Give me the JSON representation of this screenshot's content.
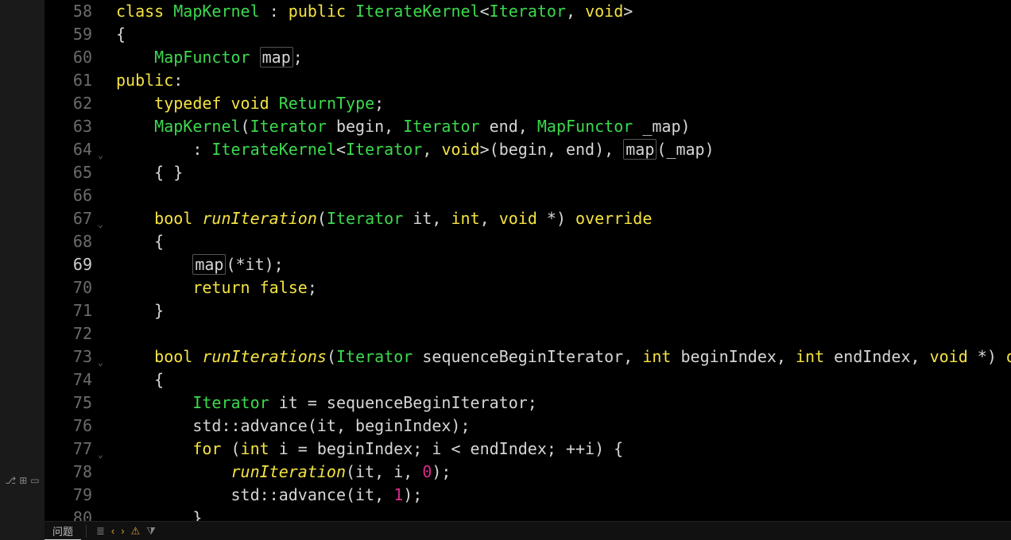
{
  "lineStart": 58,
  "lineEnd": 80,
  "activeLine": 69,
  "breakpointLine": 69,
  "foldLines": [
    64,
    67,
    73,
    77
  ],
  "code": {
    "58": [
      {
        "t": "kw",
        "v": "class"
      },
      {
        "t": "sp",
        "v": " "
      },
      {
        "t": "type",
        "v": "MapKernel"
      },
      {
        "t": "sp",
        "v": " "
      },
      {
        "t": "id",
        "v": ": "
      },
      {
        "t": "kw",
        "v": "public"
      },
      {
        "t": "sp",
        "v": " "
      },
      {
        "t": "type",
        "v": "IterateKernel"
      },
      {
        "t": "id",
        "v": "<"
      },
      {
        "t": "type",
        "v": "Iterator"
      },
      {
        "t": "id",
        "v": ", "
      },
      {
        "t": "kw",
        "v": "void"
      },
      {
        "t": "id",
        "v": ">"
      }
    ],
    "59": [
      {
        "t": "id",
        "v": "{"
      }
    ],
    "60": [
      {
        "t": "sp",
        "v": "    "
      },
      {
        "t": "type",
        "v": "MapFunctor"
      },
      {
        "t": "sp",
        "v": " "
      },
      {
        "t": "boxed",
        "v": "map"
      },
      {
        "t": "id",
        "v": ";"
      }
    ],
    "61": [
      {
        "t": "kw",
        "v": "public"
      },
      {
        "t": "id",
        "v": ":"
      }
    ],
    "62": [
      {
        "t": "sp",
        "v": "    "
      },
      {
        "t": "kw",
        "v": "typedef"
      },
      {
        "t": "sp",
        "v": " "
      },
      {
        "t": "kw",
        "v": "void"
      },
      {
        "t": "sp",
        "v": " "
      },
      {
        "t": "type",
        "v": "ReturnType"
      },
      {
        "t": "id",
        "v": ";"
      }
    ],
    "63": [
      {
        "t": "sp",
        "v": "    "
      },
      {
        "t": "type",
        "v": "MapKernel"
      },
      {
        "t": "id",
        "v": "("
      },
      {
        "t": "type",
        "v": "Iterator"
      },
      {
        "t": "sp",
        "v": " "
      },
      {
        "t": "id",
        "v": "begin, "
      },
      {
        "t": "type",
        "v": "Iterator"
      },
      {
        "t": "sp",
        "v": " "
      },
      {
        "t": "id",
        "v": "end, "
      },
      {
        "t": "type",
        "v": "MapFunctor"
      },
      {
        "t": "sp",
        "v": " "
      },
      {
        "t": "id",
        "v": "_map)"
      }
    ],
    "64": [
      {
        "t": "sp",
        "v": "        "
      },
      {
        "t": "id",
        "v": ": "
      },
      {
        "t": "type",
        "v": "IterateKernel"
      },
      {
        "t": "id",
        "v": "<"
      },
      {
        "t": "type",
        "v": "Iterator"
      },
      {
        "t": "id",
        "v": ", "
      },
      {
        "t": "kw",
        "v": "void"
      },
      {
        "t": "id",
        "v": ">(begin, end), "
      },
      {
        "t": "boxed",
        "v": "map"
      },
      {
        "t": "id",
        "v": "(_map)"
      }
    ],
    "65": [
      {
        "t": "sp",
        "v": "    "
      },
      {
        "t": "id",
        "v": "{ }"
      }
    ],
    "66": [],
    "67": [
      {
        "t": "sp",
        "v": "    "
      },
      {
        "t": "kw",
        "v": "bool"
      },
      {
        "t": "sp",
        "v": " "
      },
      {
        "t": "fn",
        "v": "runIteration"
      },
      {
        "t": "id",
        "v": "("
      },
      {
        "t": "type",
        "v": "Iterator"
      },
      {
        "t": "sp",
        "v": " "
      },
      {
        "t": "id",
        "v": "it, "
      },
      {
        "t": "kw",
        "v": "int"
      },
      {
        "t": "id",
        "v": ", "
      },
      {
        "t": "kw",
        "v": "void"
      },
      {
        "t": "sp",
        "v": " "
      },
      {
        "t": "id",
        "v": "*) "
      },
      {
        "t": "kw",
        "v": "override"
      }
    ],
    "68": [
      {
        "t": "sp",
        "v": "    "
      },
      {
        "t": "id",
        "v": "{"
      }
    ],
    "69": [
      {
        "t": "sp",
        "v": "        "
      },
      {
        "t": "boxed",
        "v": "map"
      },
      {
        "t": "id",
        "v": "(*it);"
      }
    ],
    "70": [
      {
        "t": "sp",
        "v": "        "
      },
      {
        "t": "kw",
        "v": "return"
      },
      {
        "t": "sp",
        "v": " "
      },
      {
        "t": "kw",
        "v": "false"
      },
      {
        "t": "id",
        "v": ";"
      }
    ],
    "71": [
      {
        "t": "sp",
        "v": "    "
      },
      {
        "t": "id",
        "v": "}"
      }
    ],
    "72": [],
    "73": [
      {
        "t": "sp",
        "v": "    "
      },
      {
        "t": "kw",
        "v": "bool"
      },
      {
        "t": "sp",
        "v": " "
      },
      {
        "t": "fn",
        "v": "runIterations"
      },
      {
        "t": "id",
        "v": "("
      },
      {
        "t": "type",
        "v": "Iterator"
      },
      {
        "t": "sp",
        "v": " "
      },
      {
        "t": "id",
        "v": "sequenceBeginIterator, "
      },
      {
        "t": "kw",
        "v": "int"
      },
      {
        "t": "sp",
        "v": " "
      },
      {
        "t": "id",
        "v": "beginIndex, "
      },
      {
        "t": "kw",
        "v": "int"
      },
      {
        "t": "sp",
        "v": " "
      },
      {
        "t": "id",
        "v": "endIndex, "
      },
      {
        "t": "kw",
        "v": "void"
      },
      {
        "t": "sp",
        "v": " "
      },
      {
        "t": "id",
        "v": "*) "
      },
      {
        "t": "kw",
        "v": "override"
      }
    ],
    "74": [
      {
        "t": "sp",
        "v": "    "
      },
      {
        "t": "id",
        "v": "{"
      }
    ],
    "75": [
      {
        "t": "sp",
        "v": "        "
      },
      {
        "t": "type",
        "v": "Iterator"
      },
      {
        "t": "sp",
        "v": " "
      },
      {
        "t": "id",
        "v": "it = sequenceBeginIterator;"
      }
    ],
    "76": [
      {
        "t": "sp",
        "v": "        "
      },
      {
        "t": "id",
        "v": "std::advance(it, beginIndex);"
      }
    ],
    "77": [
      {
        "t": "sp",
        "v": "        "
      },
      {
        "t": "kw",
        "v": "for"
      },
      {
        "t": "sp",
        "v": " "
      },
      {
        "t": "id",
        "v": "("
      },
      {
        "t": "kw",
        "v": "int"
      },
      {
        "t": "sp",
        "v": " "
      },
      {
        "t": "id",
        "v": "i = beginIndex; i < endIndex; ++i) {"
      }
    ],
    "78": [
      {
        "t": "sp",
        "v": "            "
      },
      {
        "t": "fn",
        "v": "runIteration"
      },
      {
        "t": "id",
        "v": "(it, i, "
      },
      {
        "t": "num",
        "v": "0"
      },
      {
        "t": "id",
        "v": ");"
      }
    ],
    "79": [
      {
        "t": "sp",
        "v": "            "
      },
      {
        "t": "id",
        "v": "std::advance(it, "
      },
      {
        "t": "num",
        "v": "1"
      },
      {
        "t": "id",
        "v": ");"
      }
    ],
    "80": [
      {
        "t": "sp",
        "v": "        "
      },
      {
        "t": "id",
        "v": "}"
      }
    ]
  },
  "panel": {
    "tab_problems": "问题"
  },
  "icons": {
    "branch": "⎇",
    "new_panel": "⊞",
    "window": "▭",
    "stack": "≣",
    "arrow_left": "‹",
    "arrow_right": "›",
    "warning": "⚠",
    "filter": "⧩"
  }
}
